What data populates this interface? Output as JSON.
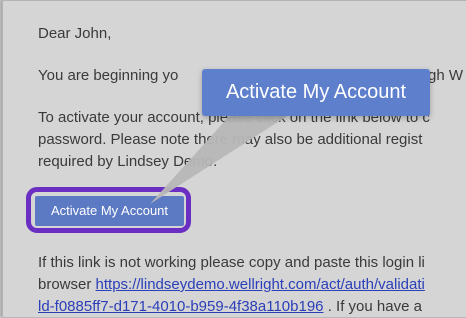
{
  "email": {
    "greeting": "Dear John,",
    "line1_start": "You are beginning yo",
    "line1_end": "gh W",
    "line2_start": "To activate your account, please click on the link below to c",
    "line3": "password. Please note there may also be additional regist",
    "line4": "required by Lindsey Demo.",
    "cta_label": "Activate My Account",
    "fallback_text": "If this link is not working please copy and paste this login li",
    "fallback_prefix": "browser ",
    "fallback_link_part1": "https://lindseydemo.wellright.com/act/auth/validati",
    "fallback_link_part2": "ld-f0885ff7-d171-4010-b959-4f38a110b196",
    "fallback_trailing": " . If you have a"
  },
  "callout": {
    "label": "Activate My Account"
  },
  "colors": {
    "background": "#d5d5d5",
    "text": "#3a3a3a",
    "link": "#2b3fb8",
    "button": "#5c79c4",
    "callout": "#5e7fcc",
    "outline": "#6a2fc2"
  }
}
